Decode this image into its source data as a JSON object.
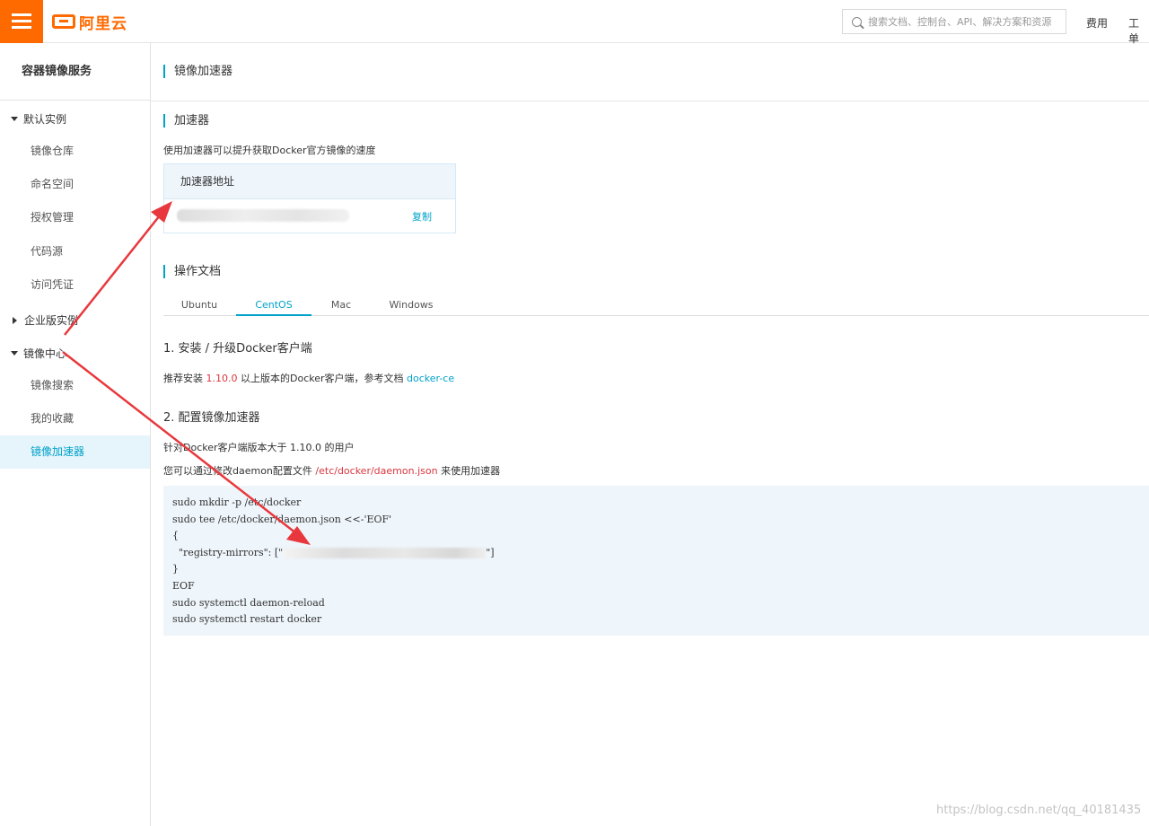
{
  "header": {
    "logo_text": "阿里云",
    "search_placeholder": "搜索文档、控制台、API、解决方案和资源",
    "links": [
      "费用",
      "工单"
    ]
  },
  "sidebar": {
    "title": "容器镜像服务",
    "groups": [
      {
        "label": "默认实例",
        "expanded": true,
        "items": [
          "镜像仓库",
          "命名空间",
          "授权管理",
          "代码源",
          "访问凭证"
        ]
      },
      {
        "label": "企业版实例",
        "expanded": false,
        "items": []
      },
      {
        "label": "镜像中心",
        "expanded": true,
        "items": [
          "镜像搜索",
          "我的收藏",
          "镜像加速器"
        ]
      }
    ],
    "active_item": "镜像加速器"
  },
  "main": {
    "page_title": "镜像加速器",
    "accelerator": {
      "title": "加速器",
      "description": "使用加速器可以提升获取Docker官方镜像的速度",
      "box_header": "加速器地址",
      "copy_label": "复制"
    },
    "docs": {
      "title": "操作文档",
      "tabs": [
        "Ubuntu",
        "CentOS",
        "Mac",
        "Windows"
      ],
      "active_tab": "CentOS",
      "step1": {
        "title": "1. 安装 / 升级Docker客户端",
        "text_before": "推荐安装 ",
        "version": "1.10.0",
        "text_middle": " 以上版本的Docker客户端，参考文档 ",
        "link": "docker-ce"
      },
      "step2": {
        "title": "2. 配置镜像加速器",
        "line1": "针对Docker客户端版本大于 1.10.0 的用户",
        "line2_before": "您可以通过修改daemon配置文件 ",
        "line2_path": "/etc/docker/daemon.json",
        "line2_after": " 来使用加速器"
      },
      "code": {
        "line1": "sudo mkdir -p /etc/docker",
        "line2": "sudo tee /etc/docker/daemon.json <<-'EOF'",
        "line3": "{",
        "line4_prefix": "  \"registry-mirrors\": [\"",
        "line4_suffix": "\"]",
        "line5": "}",
        "line6": "EOF",
        "line7": "sudo systemctl daemon-reload",
        "line8": "sudo systemctl restart docker"
      }
    }
  },
  "watermark": "https://blog.csdn.net/qq_40181435",
  "colors": {
    "brand": "#ff6a00",
    "accent": "#00a2ca",
    "annotation": "#e8383d",
    "highlight": "#d9363e"
  }
}
